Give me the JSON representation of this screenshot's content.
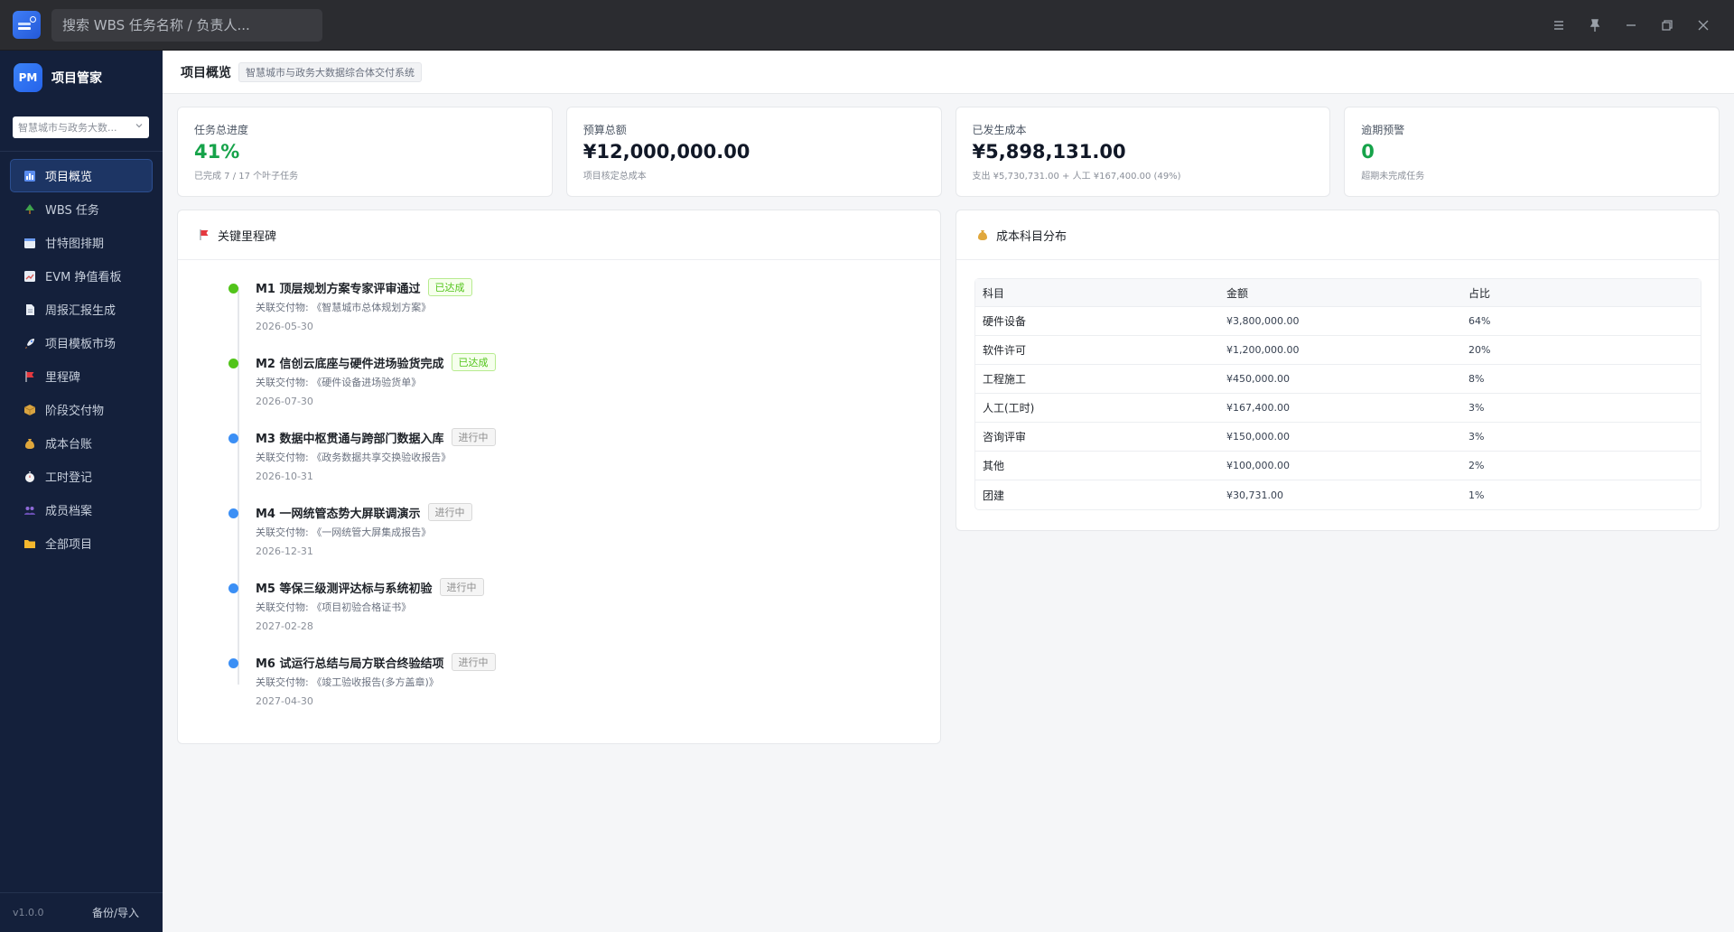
{
  "titlebar": {
    "search_placeholder": "搜索 WBS 任务名称 / 负责人..."
  },
  "sidebar": {
    "brand_badge": "PM",
    "brand_name": "项目管家",
    "project_selector": "智慧城市与政务大数...",
    "items": [
      {
        "label": "项目概览",
        "icon": "dashboard-icon",
        "active": true
      },
      {
        "label": "WBS 任务",
        "icon": "tree-icon",
        "active": false
      },
      {
        "label": "甘特图排期",
        "icon": "calendar-icon",
        "active": false
      },
      {
        "label": "EVM 挣值看板",
        "icon": "chart-icon",
        "active": false
      },
      {
        "label": "周报汇报生成",
        "icon": "document-icon",
        "active": false
      },
      {
        "label": "项目模板市场",
        "icon": "rocket-icon",
        "active": false
      },
      {
        "label": "里程碑",
        "icon": "flag-icon",
        "active": false
      },
      {
        "label": "阶段交付物",
        "icon": "package-icon",
        "active": false
      },
      {
        "label": "成本台账",
        "icon": "money-bag-icon",
        "active": false
      },
      {
        "label": "工时登记",
        "icon": "stopwatch-icon",
        "active": false
      },
      {
        "label": "成员档案",
        "icon": "people-icon",
        "active": false
      },
      {
        "label": "全部项目",
        "icon": "folder-icon",
        "active": false
      }
    ],
    "version": "v1.0.0",
    "backup_label": "备份/导入"
  },
  "header": {
    "title": "项目概览",
    "project_tag": "智慧城市与政务大数据综合体交付系统"
  },
  "stats": [
    {
      "label": "任务总进度",
      "value": "41%",
      "sub": "已完成 7 / 17 个叶子任务",
      "color": "#16a34a"
    },
    {
      "label": "预算总额",
      "value": "¥12,000,000.00",
      "sub": "项目核定总成本",
      "color": "#111827"
    },
    {
      "label": "已发生成本",
      "value": "¥5,898,131.00",
      "sub": "支出 ¥5,730,731.00 + 人工 ¥167,400.00 (49%)",
      "color": "#111827"
    },
    {
      "label": "逾期预警",
      "value": "0",
      "sub": "超期未完成任务",
      "color": "#16a34a"
    }
  ],
  "milestones": {
    "title": "关键里程碑",
    "items": [
      {
        "title": "M1 顶层规划方案专家评审通过",
        "status": "已达成",
        "state": "done",
        "deliverable": "关联交付物: 《智慧城市总体规划方案》",
        "date": "2026-05-30"
      },
      {
        "title": "M2 信创云底座与硬件进场验货完成",
        "status": "已达成",
        "state": "done",
        "deliverable": "关联交付物: 《硬件设备进场验货单》",
        "date": "2026-07-30"
      },
      {
        "title": "M3 数据中枢贯通与跨部门数据入库",
        "status": "进行中",
        "state": "doing",
        "deliverable": "关联交付物: 《政务数据共享交换验收报告》",
        "date": "2026-10-31"
      },
      {
        "title": "M4 一网统管态势大屏联调演示",
        "status": "进行中",
        "state": "doing",
        "deliverable": "关联交付物: 《一网统管大屏集成报告》",
        "date": "2026-12-31"
      },
      {
        "title": "M5 等保三级测评达标与系统初验",
        "status": "进行中",
        "state": "doing",
        "deliverable": "关联交付物: 《项目初验合格证书》",
        "date": "2027-02-28"
      },
      {
        "title": "M6 试运行总结与局方联合终验结项",
        "status": "进行中",
        "state": "doing",
        "deliverable": "关联交付物: 《竣工验收报告(多方盖章)》",
        "date": "2027-04-30"
      }
    ]
  },
  "cost": {
    "title": "成本科目分布",
    "columns": [
      "科目",
      "金额",
      "占比"
    ],
    "rows": [
      [
        "硬件设备",
        "¥3,800,000.00",
        "64%"
      ],
      [
        "软件许可",
        "¥1,200,000.00",
        "20%"
      ],
      [
        "工程施工",
        "¥450,000.00",
        "8%"
      ],
      [
        "人工(工时)",
        "¥167,400.00",
        "3%"
      ],
      [
        "咨询评审",
        "¥150,000.00",
        "3%"
      ],
      [
        "其他",
        "¥100,000.00",
        "2%"
      ],
      [
        "团建",
        "¥30,731.00",
        "1%"
      ]
    ]
  }
}
